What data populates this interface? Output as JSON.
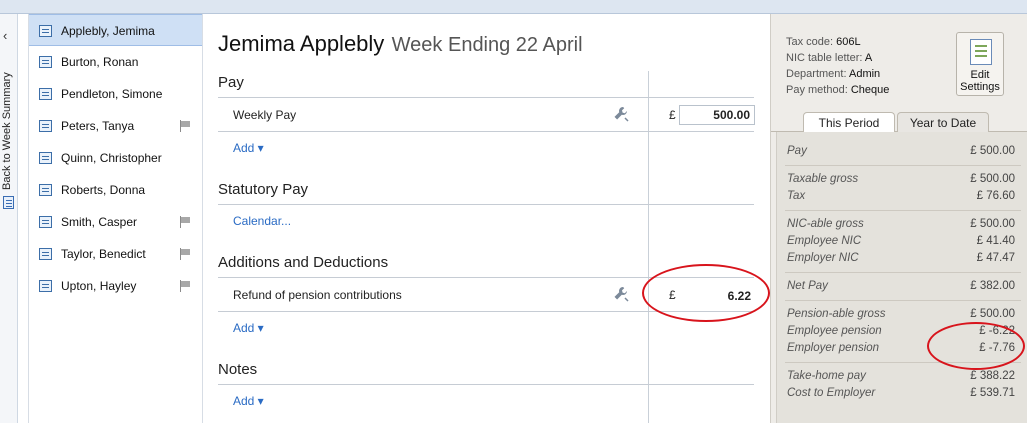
{
  "back_strip": {
    "label": "Back to Week Summary"
  },
  "employees": [
    {
      "name": "Applebly, Jemima",
      "flag": false,
      "selected": true
    },
    {
      "name": "Burton, Ronan",
      "flag": false
    },
    {
      "name": "Pendleton, Simone",
      "flag": false
    },
    {
      "name": "Peters, Tanya",
      "flag": true
    },
    {
      "name": "Quinn, Christopher",
      "flag": false
    },
    {
      "name": "Roberts, Donna",
      "flag": false
    },
    {
      "name": "Smith, Casper",
      "flag": true
    },
    {
      "name": "Taylor, Benedict",
      "flag": true
    },
    {
      "name": "Upton, Hayley",
      "flag": true
    }
  ],
  "header": {
    "name": "Jemima Applebly",
    "week": "Week Ending 22 April"
  },
  "sections": {
    "pay": {
      "title": "Pay",
      "row_label": "Weekly Pay",
      "currency": "£",
      "amount": "500.00",
      "add": "Add ▾"
    },
    "statutory": {
      "title": "Statutory Pay",
      "link": "Calendar..."
    },
    "additions": {
      "title": "Additions and Deductions",
      "row_label": "Refund of pension contributions",
      "currency": "£",
      "amount": "6.22",
      "add": "Add ▾"
    },
    "notes": {
      "title": "Notes",
      "add": "Add ▾"
    }
  },
  "side": {
    "tax_code_label": "Tax code:",
    "tax_code": "606L",
    "nic_label": "NIC table letter:",
    "nic": "A",
    "dept_label": "Department:",
    "dept": "Admin",
    "paymethod_label": "Pay method:",
    "paymethod": "Cheque",
    "edit_button": "Edit Settings",
    "tabs": [
      "This Period",
      "Year to Date"
    ],
    "rows": [
      {
        "label": "Pay",
        "value": "£ 500.00"
      },
      {
        "label": "Taxable gross",
        "value": "£ 500.00"
      },
      {
        "label": "Tax",
        "value": "£ 76.60"
      },
      {
        "label": "NIC-able gross",
        "value": "£ 500.00"
      },
      {
        "label": "Employee NIC",
        "value": "£ 41.40"
      },
      {
        "label": "Employer NIC",
        "value": "£ 47.47"
      },
      {
        "label": "Net Pay",
        "value": "£ 382.00"
      },
      {
        "label": "Pension-able gross",
        "value": "£ 500.00"
      },
      {
        "label": "Employee pension",
        "value": "£ -6.22"
      },
      {
        "label": "Employer pension",
        "value": "£ -7.76"
      },
      {
        "label": "Take-home pay",
        "value": "£ 388.22"
      },
      {
        "label": "Cost to Employer",
        "value": "£ 539.71"
      }
    ]
  },
  "colors": {
    "annotation": "#d8141c",
    "link": "#2a6bc4",
    "selected": "#cfe0f5"
  }
}
